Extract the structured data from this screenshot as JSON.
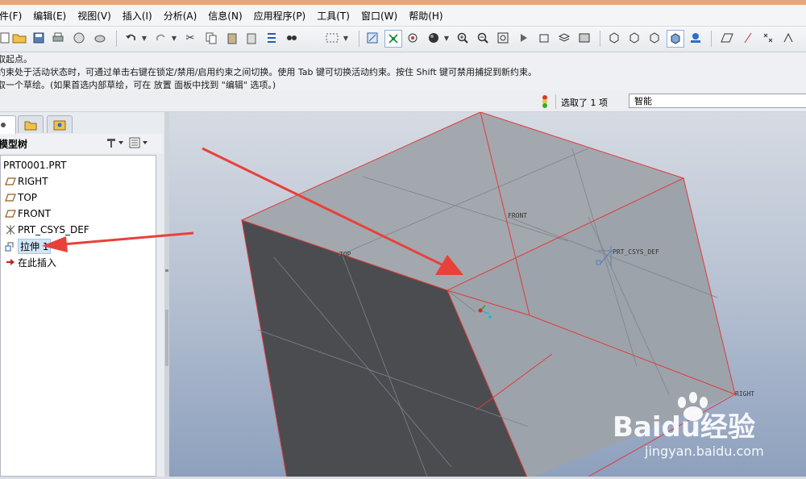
{
  "menu": [
    "件(F)",
    "编辑(E)",
    "视图(V)",
    "插入(I)",
    "分析(A)",
    "信息(N)",
    "应用程序(P)",
    "工具(T)",
    "窗口(W)",
    "帮助(H)"
  ],
  "messages": [
    "取起点。",
    "约束处于活动状态时，可通过单击右键在锁定/禁用/启用约束之间切换。使用 Tab 键可切换活动约束。按住 Shift 键可禁用捕捉到新约束。",
    "取一个草绘。(如果首选内部草绘，可在 放置 面板中找到 \"编辑\" 选项。)"
  ],
  "status": {
    "selected_text": "选取了 1 项",
    "filter_value": "智能"
  },
  "model_tree": {
    "title": "模型树",
    "items": [
      {
        "label": "PRT0001.PRT",
        "icon": "part-icon"
      },
      {
        "label": "RIGHT",
        "icon": "datum-plane-icon"
      },
      {
        "label": "TOP",
        "icon": "datum-plane-icon"
      },
      {
        "label": "FRONT",
        "icon": "datum-plane-icon"
      },
      {
        "label": "PRT_CSYS_DEF",
        "icon": "csys-icon"
      },
      {
        "label": "拉伸 1",
        "icon": "extrude-icon"
      },
      {
        "label": "在此插入",
        "icon": "insert-arrow-icon"
      }
    ]
  },
  "viewport": {
    "labels": {
      "front": "FRONT",
      "top": "TOP",
      "csys": "PRT_CSYS_DEF",
      "right": "RIGHT"
    }
  },
  "watermark": {
    "brand": "Baidu经验",
    "url": "jingyan.baidu.com"
  },
  "colors": {
    "annotation_arrow": "#e8413a",
    "edge_highlight": "#e03a3a",
    "face_light": "#a3a8ae",
    "face_dark": "#4a4c50"
  }
}
